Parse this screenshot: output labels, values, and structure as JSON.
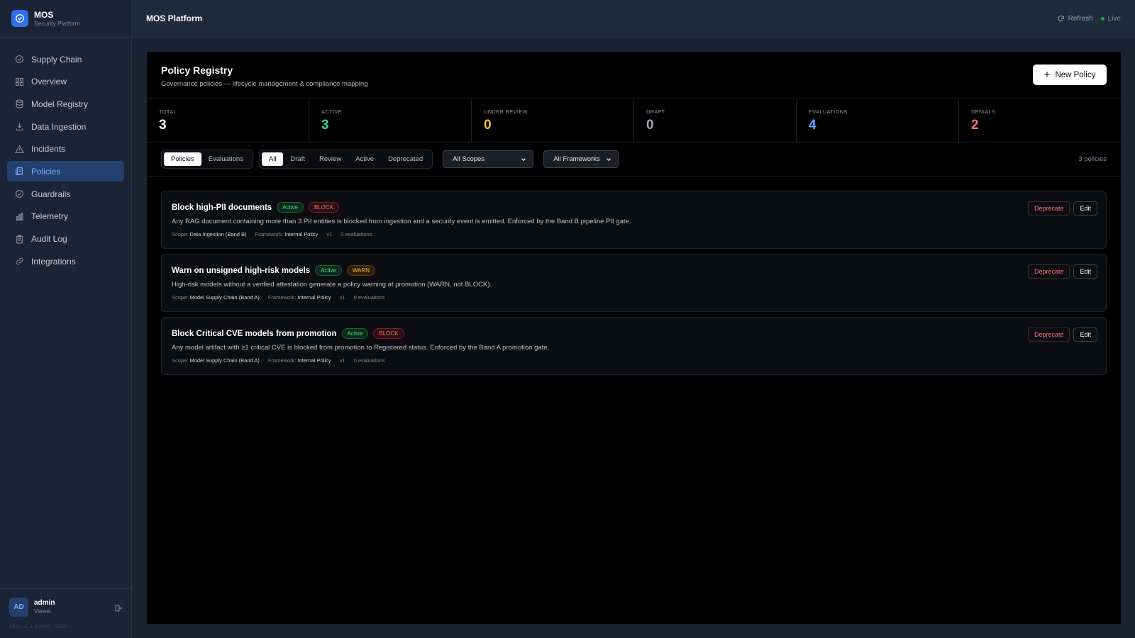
{
  "brand": {
    "name": "MOS",
    "subtitle": "Security Platform"
  },
  "sidebar": {
    "items": [
      {
        "label": "Supply Chain",
        "icon": "shield-check-icon",
        "active": false
      },
      {
        "label": "Overview",
        "icon": "grid-icon",
        "active": false
      },
      {
        "label": "Model Registry",
        "icon": "database-icon",
        "active": false
      },
      {
        "label": "Data Ingestion",
        "icon": "download-icon",
        "active": false
      },
      {
        "label": "Incidents",
        "icon": "alert-triangle-icon",
        "active": false
      },
      {
        "label": "Policies",
        "icon": "file-stack-icon",
        "active": true
      },
      {
        "label": "Guardrails",
        "icon": "shield-check-icon",
        "active": false
      },
      {
        "label": "Telemetry",
        "icon": "bar-chart-icon",
        "active": false
      },
      {
        "label": "Audit Log",
        "icon": "clipboard-icon",
        "active": false
      },
      {
        "label": "Integrations",
        "icon": "link-icon",
        "active": false
      }
    ]
  },
  "user": {
    "initials": "AD",
    "name": "admin",
    "role": "Viewer",
    "version": "MOS v0.1.0-MVP · WS2"
  },
  "topbar": {
    "title": "MOS Platform",
    "refresh_label": "Refresh",
    "live_label": "Live"
  },
  "panel": {
    "title": "Policy Registry",
    "subtitle": "Governance policies — lifecycle management & compliance mapping",
    "new_button": "New Policy"
  },
  "stats": [
    {
      "label": "TOTAL",
      "value": "3",
      "color": "#ffffff"
    },
    {
      "label": "ACTIVE",
      "value": "3",
      "color": "#34d399"
    },
    {
      "label": "UNDER REVIEW",
      "value": "0",
      "color": "#fbbf24"
    },
    {
      "label": "DRAFT",
      "value": "0",
      "color": "#9ca3af"
    },
    {
      "label": "EVALUATIONS",
      "value": "4",
      "color": "#60a5fa"
    },
    {
      "label": "DENIALS",
      "value": "2",
      "color": "#f87171"
    }
  ],
  "filters": {
    "view_tabs": [
      "Policies",
      "Evaluations"
    ],
    "view_selected": "Policies",
    "status_tabs": [
      "All",
      "Draft",
      "Review",
      "Active",
      "Deprecated"
    ],
    "status_selected": "All",
    "scope_select": "All Scopes",
    "framework_select": "All Frameworks",
    "count_label": "3 policies"
  },
  "policies": [
    {
      "title": "Block high-PII documents",
      "status": "Active",
      "action": "BLOCK",
      "action_type": "block",
      "description": "Any RAG document containing more than 3 PII entities is blocked from ingestion and a security event is emitted. Enforced by the Band B pipeline PII gate.",
      "scope_label": "Scope:",
      "scope": "Data Ingestion (Band B)",
      "framework_label": "Framework:",
      "framework": "Internal Policy",
      "version": "v1",
      "evaluations": "0 evaluations",
      "deprecate_label": "Deprecate",
      "edit_label": "Edit"
    },
    {
      "title": "Warn on unsigned high-risk models",
      "status": "Active",
      "action": "WARN",
      "action_type": "warn",
      "description": "High-risk models without a verified attestation generate a policy warning at promotion (WARN, not BLOCK).",
      "scope_label": "Scope:",
      "scope": "Model Supply Chain (Band A)",
      "framework_label": "Framework:",
      "framework": "Internal Policy",
      "version": "v1",
      "evaluations": "0 evaluations",
      "deprecate_label": "Deprecate",
      "edit_label": "Edit"
    },
    {
      "title": "Block Critical CVE models from promotion",
      "status": "Active",
      "action": "BLOCK",
      "action_type": "block",
      "description": "Any model artifact with ≥1 critical CVE is blocked from promotion to Registered status. Enforced by the Band A promotion gate.",
      "scope_label": "Scope:",
      "scope": "Model Supply Chain (Band A)",
      "framework_label": "Framework:",
      "framework": "Internal Policy",
      "version": "v1",
      "evaluations": "0 evaluations",
      "deprecate_label": "Deprecate",
      "edit_label": "Edit"
    }
  ]
}
